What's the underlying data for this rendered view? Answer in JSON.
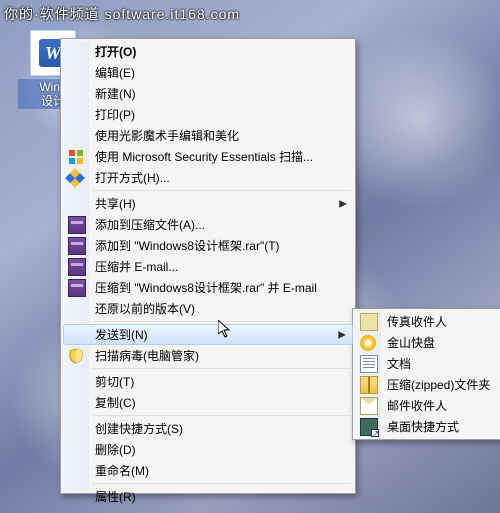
{
  "watermark": {
    "text": "你的·软件频道",
    "url": "software.it168.com"
  },
  "file": {
    "label_line1": "Wind",
    "label_line2": "设计"
  },
  "main_menu": [
    {
      "type": "item",
      "name": "open",
      "label": "打开(O)",
      "bold": true
    },
    {
      "type": "item",
      "name": "edit",
      "label": "编辑(E)"
    },
    {
      "type": "item",
      "name": "new",
      "label": "新建(N)"
    },
    {
      "type": "item",
      "name": "print",
      "label": "打印(P)"
    },
    {
      "type": "item",
      "name": "magic-edit",
      "label": "使用光影魔术手编辑和美化"
    },
    {
      "type": "item",
      "name": "mse-scan",
      "label": "使用 Microsoft Security Essentials 扫描...",
      "icon": "win"
    },
    {
      "type": "item",
      "name": "open-with",
      "label": "打开方式(H)...",
      "icon": "shield"
    },
    {
      "type": "sep"
    },
    {
      "type": "item",
      "name": "share",
      "label": "共享(H)",
      "arrow": true
    },
    {
      "type": "item",
      "name": "rar-add",
      "label": "添加到压缩文件(A)...",
      "icon": "rar"
    },
    {
      "type": "item",
      "name": "rar-add-to",
      "label": "添加到 \"Windows8设计框架.rar\"(T)",
      "icon": "rar"
    },
    {
      "type": "item",
      "name": "rar-email",
      "label": "压缩并 E-mail...",
      "icon": "rar"
    },
    {
      "type": "item",
      "name": "rar-to-email",
      "label": "压缩到 \"Windows8设计框架.rar\" 并 E-mail",
      "icon": "rar"
    },
    {
      "type": "item",
      "name": "restore-prev",
      "label": "还原以前的版本(V)"
    },
    {
      "type": "sep"
    },
    {
      "type": "item",
      "name": "send-to",
      "label": "发送到(N)",
      "arrow": true,
      "hover": true
    },
    {
      "type": "item",
      "name": "scan-virus",
      "label": "扫描病毒(电脑管家)",
      "icon": "shield2"
    },
    {
      "type": "sep"
    },
    {
      "type": "item",
      "name": "cut",
      "label": "剪切(T)"
    },
    {
      "type": "item",
      "name": "copy",
      "label": "复制(C)"
    },
    {
      "type": "sep"
    },
    {
      "type": "item",
      "name": "shortcut",
      "label": "创建快捷方式(S)"
    },
    {
      "type": "item",
      "name": "delete",
      "label": "删除(D)"
    },
    {
      "type": "item",
      "name": "rename",
      "label": "重命名(M)"
    },
    {
      "type": "sep"
    },
    {
      "type": "item",
      "name": "properties",
      "label": "属性(R)"
    }
  ],
  "sub_menu": [
    {
      "name": "fax-recipient",
      "label": "传真收件人",
      "icon": "fax"
    },
    {
      "name": "jinshan-disk",
      "label": "金山快盘",
      "icon": "disk"
    },
    {
      "name": "documents",
      "label": "文档",
      "icon": "doc"
    },
    {
      "name": "zipped-folder",
      "label": "压缩(zipped)文件夹",
      "icon": "zip"
    },
    {
      "name": "mail-recipient",
      "label": "邮件收件人",
      "icon": "mail"
    },
    {
      "name": "desktop-shortcut",
      "label": "桌面快捷方式",
      "icon": "desk"
    }
  ]
}
